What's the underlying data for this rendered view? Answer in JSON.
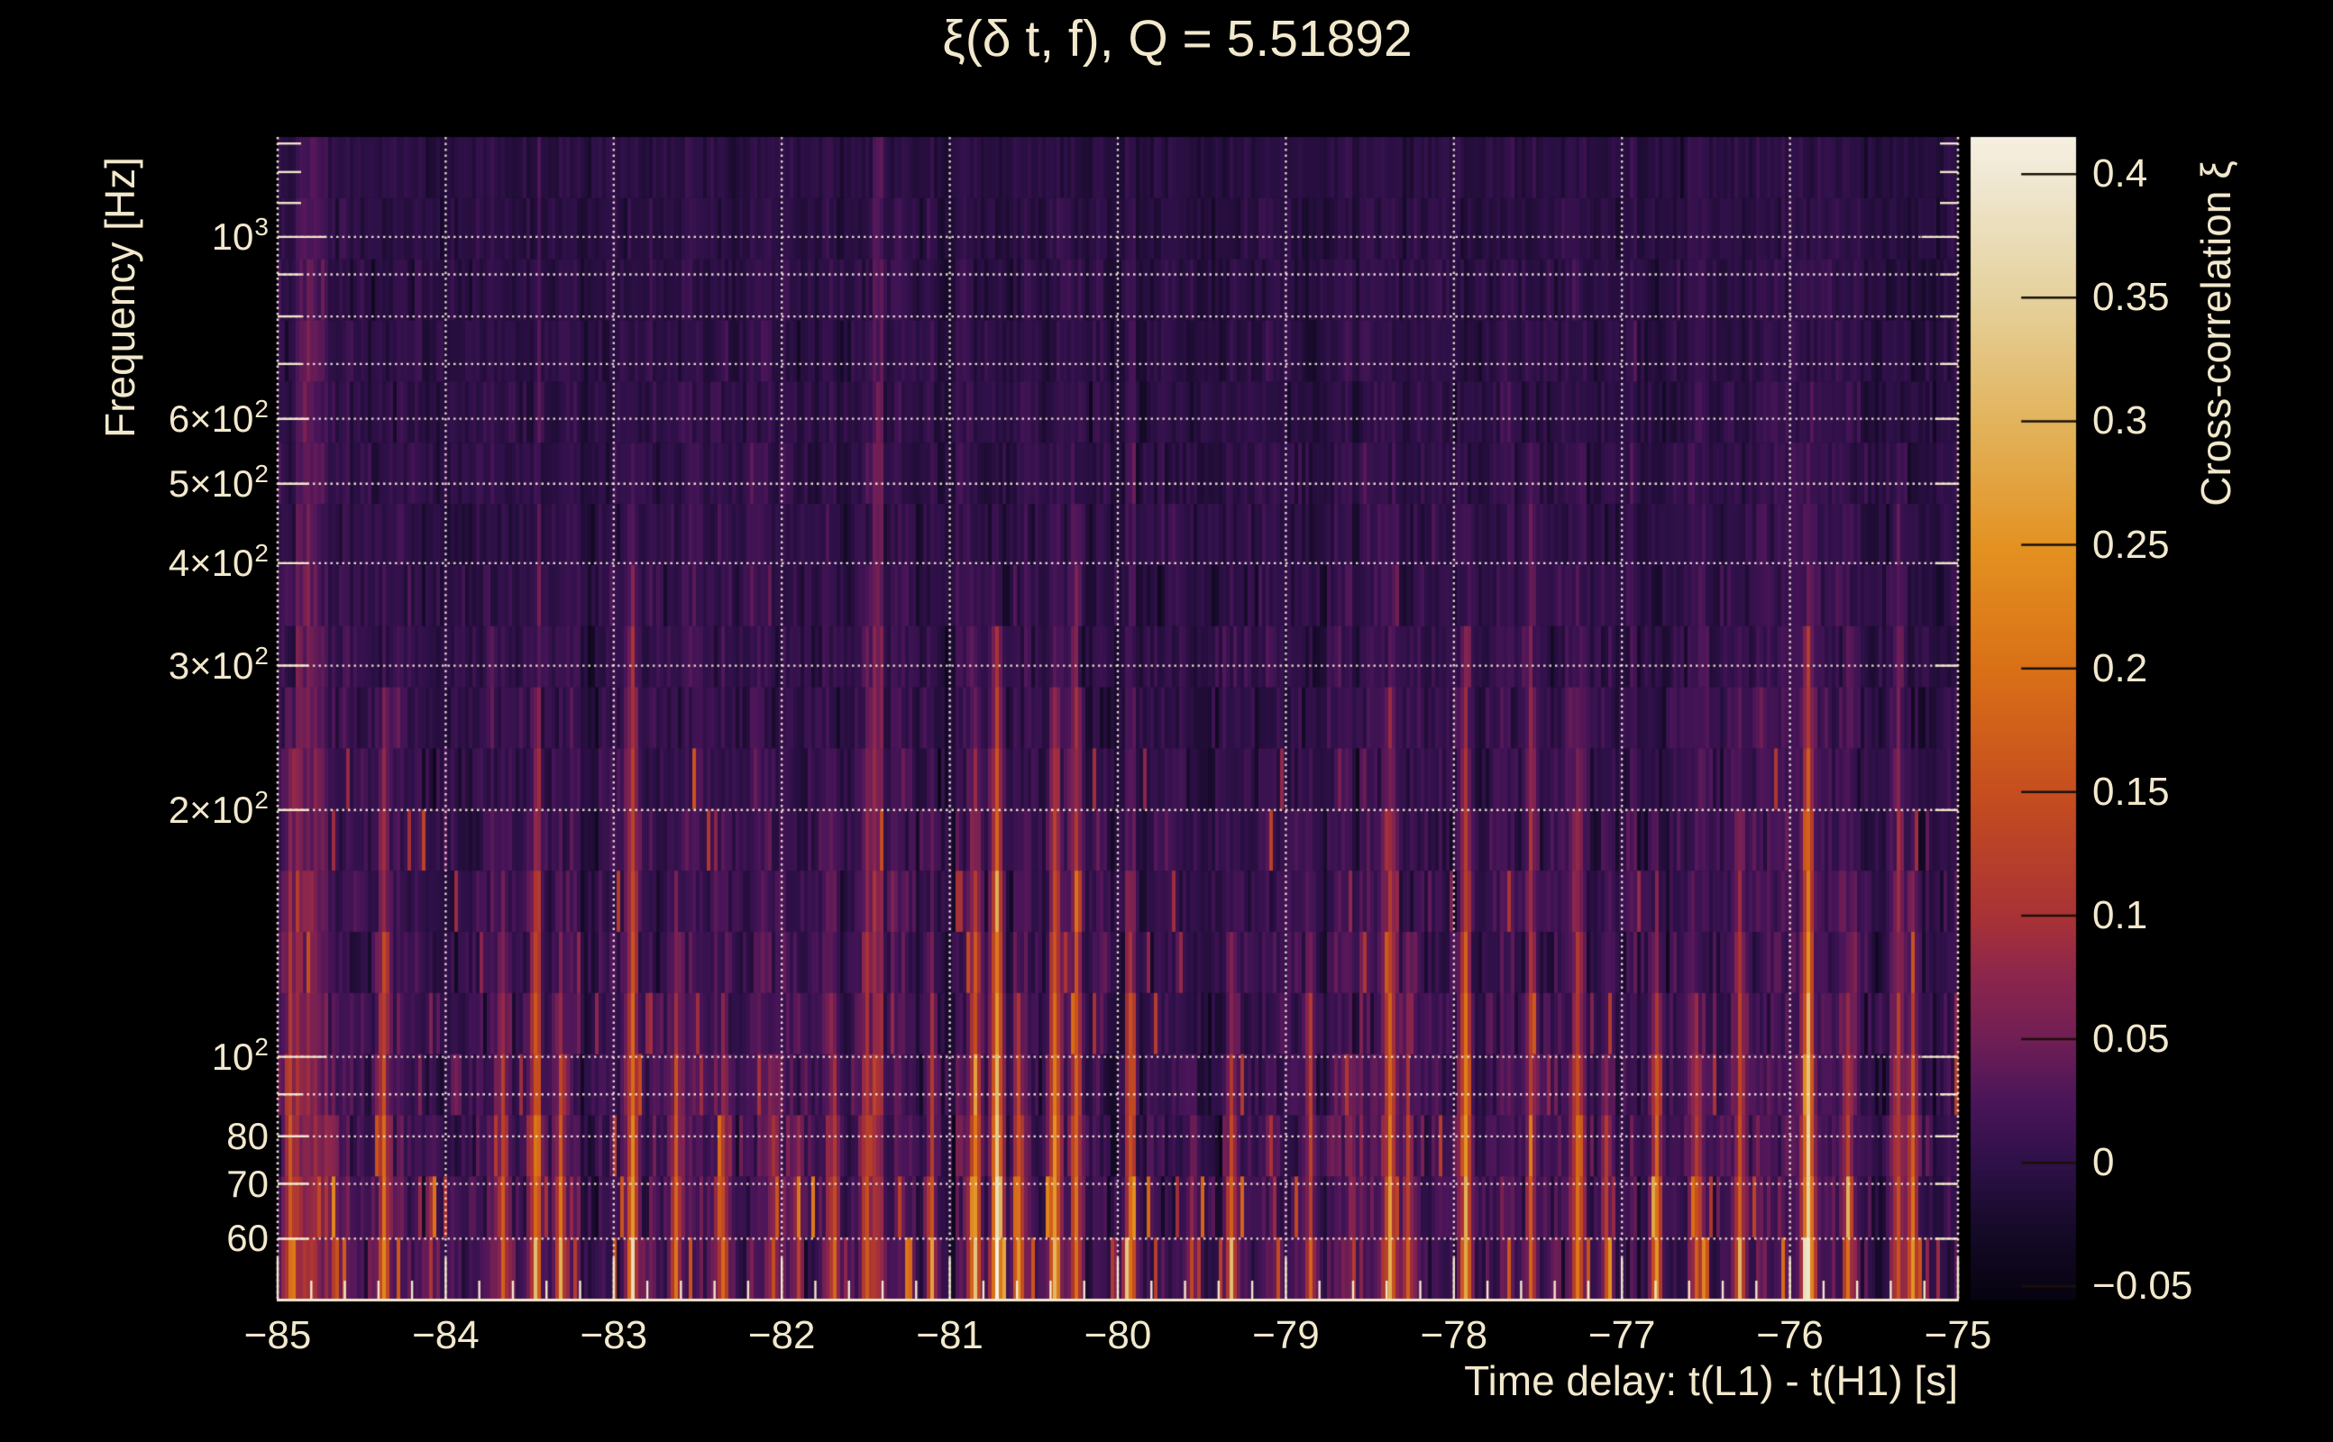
{
  "page": {
    "background": "#000000",
    "title": "ξ(δ t, f), Q = 5.51892"
  },
  "colors": {
    "text": "#f2e8cc",
    "grid": "#f5edd7",
    "frame": "#f2e8cc",
    "colorbar_tick": "#1a1008"
  },
  "axes": {
    "x": {
      "title": "Time delay: t(L1) - t(H1) [s]",
      "range": [
        -85,
        -75
      ],
      "minor_tick_step": 0.2,
      "ticks": [
        {
          "value": -85,
          "label": "−85"
        },
        {
          "value": -84,
          "label": "−84"
        },
        {
          "value": -83,
          "label": "−83"
        },
        {
          "value": -82,
          "label": "−82"
        },
        {
          "value": -81,
          "label": "−81"
        },
        {
          "value": -80,
          "label": "−80"
        },
        {
          "value": -79,
          "label": "−79"
        },
        {
          "value": -78,
          "label": "−78"
        },
        {
          "value": -77,
          "label": "−77"
        },
        {
          "value": -76,
          "label": "−76"
        },
        {
          "value": -75,
          "label": "−75"
        }
      ]
    },
    "y": {
      "title": "Frequency [Hz]",
      "scale": "log",
      "range_hz": [
        50.7,
        1324
      ],
      "ticks": [
        {
          "value": 1000,
          "base": "10",
          "exp": "3",
          "size": "major"
        },
        {
          "value": 600,
          "base": "6×10",
          "exp": "2",
          "size": "labeled"
        },
        {
          "value": 500,
          "base": "5×10",
          "exp": "2",
          "size": "labeled"
        },
        {
          "value": 400,
          "base": "4×10",
          "exp": "2",
          "size": "labeled"
        },
        {
          "value": 300,
          "base": "3×10",
          "exp": "2",
          "size": "labeled"
        },
        {
          "value": 200,
          "base": "2×10",
          "exp": "2",
          "size": "labeled"
        },
        {
          "value": 100,
          "base": "10",
          "exp": "2",
          "size": "major"
        },
        {
          "value": 80,
          "base": "80",
          "exp": "",
          "size": "labeled"
        },
        {
          "value": 70,
          "base": "70",
          "exp": "",
          "size": "labeled"
        },
        {
          "value": 60,
          "base": "60",
          "exp": "",
          "size": "labeled"
        }
      ],
      "minor_tick_values": [
        900,
        800,
        700,
        90,
        1100,
        1200,
        1300
      ],
      "gridline_values": [
        60,
        70,
        80,
        90,
        100,
        200,
        300,
        400,
        500,
        600,
        700,
        800,
        900,
        1000
      ]
    },
    "z": {
      "title": "Cross-correlation ξ",
      "range": [
        -0.055,
        0.415
      ],
      "ticks": [
        {
          "value": 0.4,
          "label": "0.4"
        },
        {
          "value": 0.35,
          "label": "0.35"
        },
        {
          "value": 0.3,
          "label": "0.3"
        },
        {
          "value": 0.25,
          "label": "0.25"
        },
        {
          "value": 0.2,
          "label": "0.2"
        },
        {
          "value": 0.15,
          "label": "0.15"
        },
        {
          "value": 0.1,
          "label": "0.1"
        },
        {
          "value": 0.05,
          "label": "0.05"
        },
        {
          "value": 0,
          "label": "0"
        },
        {
          "value": -0.05,
          "label": "−0.05"
        }
      ]
    }
  },
  "chart_data": {
    "type": "heatmap",
    "title": "ξ(δ t, f), Q = 5.51892",
    "q_value": 5.51892,
    "xlabel": "Time delay: t(L1) - t(H1) [s]",
    "ylabel": "Frequency [Hz]",
    "zlabel": "Cross-correlation ξ",
    "x_range_s": [
      -85,
      -75
    ],
    "y_range_hz": [
      50.7,
      1324
    ],
    "y_scale": "log",
    "z_range": [
      -0.055,
      0.415
    ],
    "grid": "dotted cream, x every 1 s, y at 6-10 per decade",
    "legend_position": "right colorbar",
    "background_noise": {
      "mean": 0.0,
      "sd": 0.012,
      "description": "dark purple vertical striation, brighter toward low frequency"
    },
    "colormap_stops": [
      {
        "u": 0.0,
        "hex": "#070310"
      },
      {
        "u": 0.06,
        "hex": "#150a28"
      },
      {
        "u": 0.116,
        "hex": "#2e1048"
      },
      {
        "u": 0.17,
        "hex": "#4a1559"
      },
      {
        "u": 0.222,
        "hex": "#6f1e55"
      },
      {
        "u": 0.28,
        "hex": "#8d264c"
      },
      {
        "u": 0.328,
        "hex": "#a83236"
      },
      {
        "u": 0.433,
        "hex": "#c54d1f"
      },
      {
        "u": 0.539,
        "hex": "#d96f17"
      },
      {
        "u": 0.645,
        "hex": "#e39121"
      },
      {
        "u": 0.75,
        "hex": "#e2b259"
      },
      {
        "u": 0.856,
        "hex": "#e5d09a"
      },
      {
        "u": 0.962,
        "hex": "#efe7d1"
      },
      {
        "u": 1.0,
        "hex": "#f6f0e2"
      }
    ],
    "streaks": [
      {
        "t": -84.92,
        "fmax_hz": 300,
        "peak": 0.2
      },
      {
        "t": -84.66,
        "fmax_hz": 100,
        "peak": 0.13
      },
      {
        "t": -84.37,
        "fmax_hz": 260,
        "peak": 0.23
      },
      {
        "t": -84.08,
        "fmax_hz": 80,
        "peak": 0.11
      },
      {
        "t": -83.66,
        "fmax_hz": 160,
        "peak": 0.19
      },
      {
        "t": -83.47,
        "fmax_hz": 220,
        "peak": 0.22
      },
      {
        "t": -83.31,
        "fmax_hz": 130,
        "peak": 0.22
      },
      {
        "t": -82.88,
        "fmax_hz": 430,
        "peak": 0.26
      },
      {
        "t": -82.62,
        "fmax_hz": 150,
        "peak": 0.22
      },
      {
        "t": -82.34,
        "fmax_hz": 110,
        "peak": 0.18
      },
      {
        "t": -82.06,
        "fmax_hz": 95,
        "peak": 0.15
      },
      {
        "t": -81.9,
        "fmax_hz": 90,
        "peak": 0.14
      },
      {
        "t": -81.68,
        "fmax_hz": 130,
        "peak": 0.16
      },
      {
        "t": -81.49,
        "fmax_hz": 400,
        "peak": 0.15
      },
      {
        "t": -81.1,
        "fmax_hz": 150,
        "peak": 0.16
      },
      {
        "t": -80.85,
        "fmax_hz": 230,
        "peak": 0.28
      },
      {
        "t": -80.71,
        "fmax_hz": 330,
        "peak": 0.42
      },
      {
        "t": -80.6,
        "fmax_hz": 120,
        "peak": 0.24
      },
      {
        "t": -80.37,
        "fmax_hz": 300,
        "peak": 0.3
      },
      {
        "t": -80.25,
        "fmax_hz": 500,
        "peak": 0.21
      },
      {
        "t": -79.93,
        "fmax_hz": 170,
        "peak": 0.2
      },
      {
        "t": -79.55,
        "fmax_hz": 90,
        "peak": 0.13
      },
      {
        "t": -79.33,
        "fmax_hz": 140,
        "peak": 0.22
      },
      {
        "t": -78.85,
        "fmax_hz": 200,
        "peak": 0.16
      },
      {
        "t": -78.6,
        "fmax_hz": 100,
        "peak": 0.14
      },
      {
        "t": -78.38,
        "fmax_hz": 260,
        "peak": 0.25
      },
      {
        "t": -78.28,
        "fmax_hz": 150,
        "peak": 0.2
      },
      {
        "t": -77.92,
        "fmax_hz": 330,
        "peak": 0.33
      },
      {
        "t": -77.54,
        "fmax_hz": 560,
        "peak": 0.17
      },
      {
        "t": -77.26,
        "fmax_hz": 260,
        "peak": 0.18
      },
      {
        "t": -77.1,
        "fmax_hz": 120,
        "peak": 0.16
      },
      {
        "t": -76.8,
        "fmax_hz": 160,
        "peak": 0.28
      },
      {
        "t": -76.55,
        "fmax_hz": 120,
        "peak": 0.15
      },
      {
        "t": -76.3,
        "fmax_hz": 210,
        "peak": 0.2
      },
      {
        "t": -75.89,
        "fmax_hz": 350,
        "peak": 0.41
      },
      {
        "t": -75.66,
        "fmax_hz": 140,
        "peak": 0.17
      },
      {
        "t": -75.36,
        "fmax_hz": 460,
        "peak": 0.15
      },
      {
        "t": -75.26,
        "fmax_hz": 170,
        "peak": 0.26
      }
    ]
  }
}
